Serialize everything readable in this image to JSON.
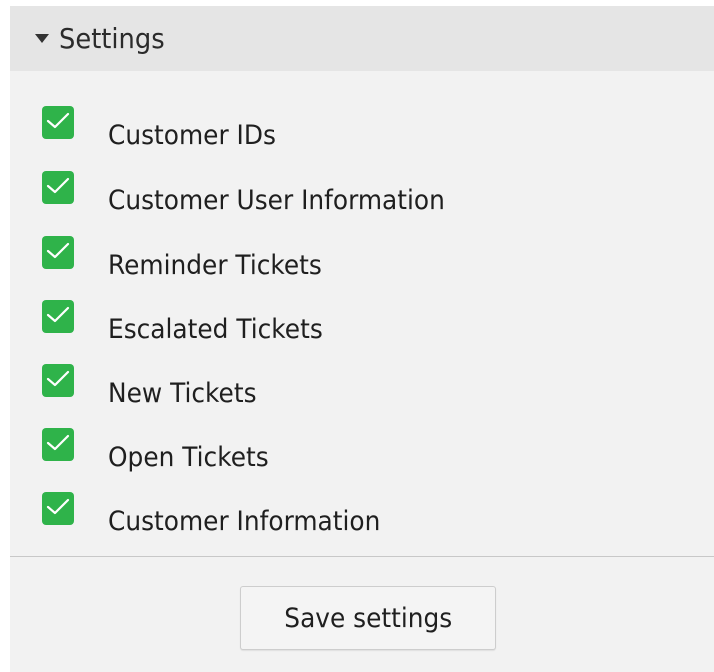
{
  "panel": {
    "title": "Settings",
    "toggle_icon": "caret-down-icon"
  },
  "settings": {
    "items": [
      {
        "label": "Customer IDs",
        "checked": true
      },
      {
        "label": "Customer User Information",
        "checked": true
      },
      {
        "label": "Reminder Tickets",
        "checked": true
      },
      {
        "label": "Escalated Tickets",
        "checked": true
      },
      {
        "label": "New Tickets",
        "checked": true
      },
      {
        "label": "Open Tickets",
        "checked": true
      },
      {
        "label": "Customer Information",
        "checked": true
      }
    ],
    "checkbox_icon": "checkmark-icon"
  },
  "footer": {
    "save_label": "Save settings"
  },
  "colors": {
    "checkbox_checked": "#2fb34a",
    "header_background": "#e5e5e5",
    "panel_background": "#f2f2f2"
  }
}
